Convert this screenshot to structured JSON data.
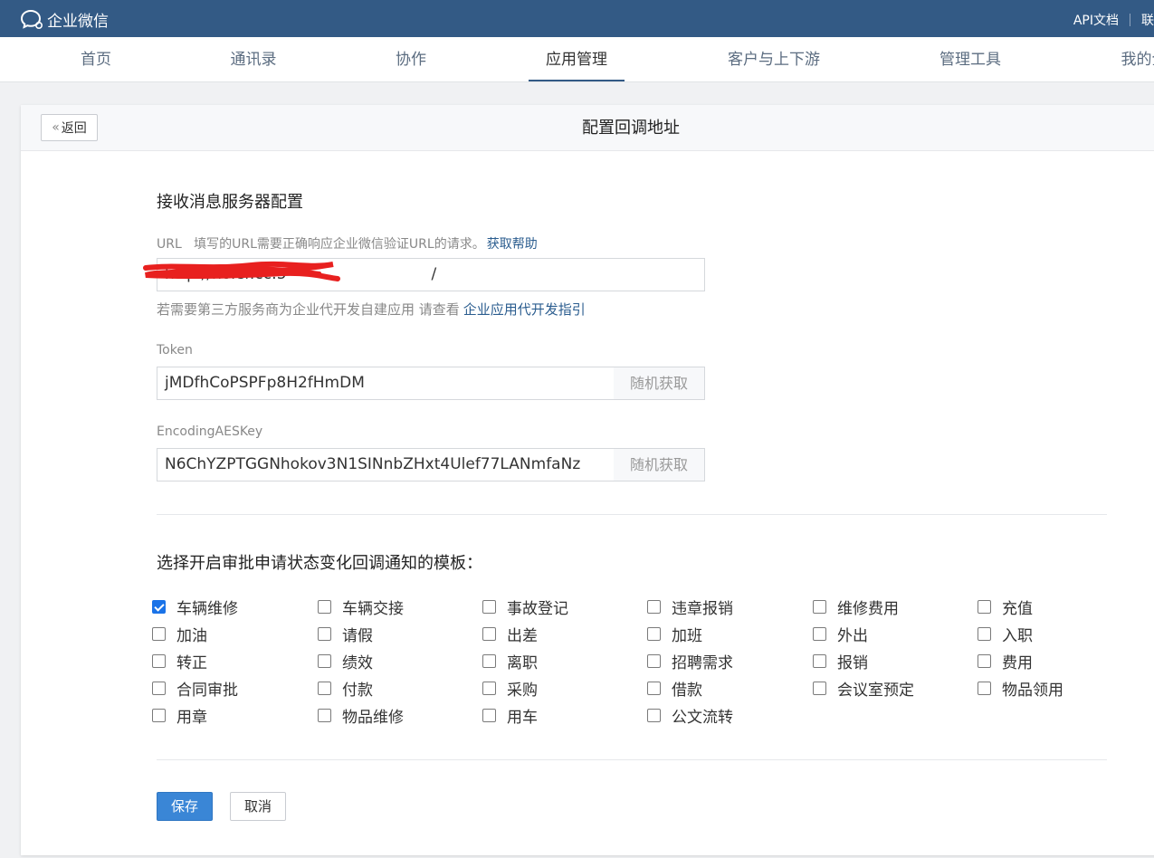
{
  "topbar": {
    "logo_icon": "chat-bubble-icon",
    "logo_text": "企业微信",
    "links": [
      "API文档",
      "联"
    ]
  },
  "nav": {
    "items": [
      {
        "label": "首页"
      },
      {
        "label": "通讯录"
      },
      {
        "label": "协作"
      },
      {
        "label": "应用管理",
        "active": true
      },
      {
        "label": "客户与上下游"
      },
      {
        "label": "管理工具"
      },
      {
        "label": "我的企"
      }
    ]
  },
  "page": {
    "back_label": "返回",
    "title": "配置回调地址"
  },
  "server_config": {
    "title": "接收消息服务器配置",
    "url_label": "URL",
    "url_hint": "填写的URL需要正确响应企业微信验证URL的请求。",
    "url_help_link": "获取帮助",
    "url_value": "http://holer.cc:5",
    "url_value_tail": "/",
    "third_party_note": "若需要第三方服务商为企业代开发自建应用 请查看",
    "third_party_link": "企业应用代开发指引",
    "token_label": "Token",
    "token_value": "jMDfhCoPSPFp8H2fHmDM",
    "aeskey_label": "EncodingAESKey",
    "aeskey_value": "N6ChYZPTGGNhokov3N1SINnbZHxt4Ulef77LANmfaNz",
    "random_button_label": "随机获取"
  },
  "templates": {
    "title": "选择开启审批申请状态变化回调通知的模板：",
    "rows": [
      [
        {
          "label": "车辆维修",
          "checked": true
        },
        {
          "label": "车辆交接"
        },
        {
          "label": "事故登记"
        },
        {
          "label": "违章报销"
        },
        {
          "label": "维修费用"
        },
        {
          "label": "充值"
        }
      ],
      [
        {
          "label": "加油"
        },
        {
          "label": "请假"
        },
        {
          "label": "出差"
        },
        {
          "label": "加班"
        },
        {
          "label": "外出"
        },
        {
          "label": "入职"
        }
      ],
      [
        {
          "label": "转正"
        },
        {
          "label": "绩效"
        },
        {
          "label": "离职"
        },
        {
          "label": "招聘需求"
        },
        {
          "label": "报销"
        },
        {
          "label": "费用"
        }
      ],
      [
        {
          "label": "合同审批"
        },
        {
          "label": "付款"
        },
        {
          "label": "采购"
        },
        {
          "label": "借款"
        },
        {
          "label": "会议室预定"
        },
        {
          "label": "物品领用"
        }
      ],
      [
        {
          "label": "用章"
        },
        {
          "label": "物品维修"
        },
        {
          "label": "用车"
        },
        {
          "label": "公文流转"
        }
      ]
    ]
  },
  "actions": {
    "save_label": "保存",
    "cancel_label": "取消"
  },
  "colors": {
    "topbar": "#335a85",
    "primary_button": "#3a86d6",
    "link": "#2b5d8f",
    "checkbox_checked": "#1a73e8",
    "redaction": "#e8201f"
  }
}
